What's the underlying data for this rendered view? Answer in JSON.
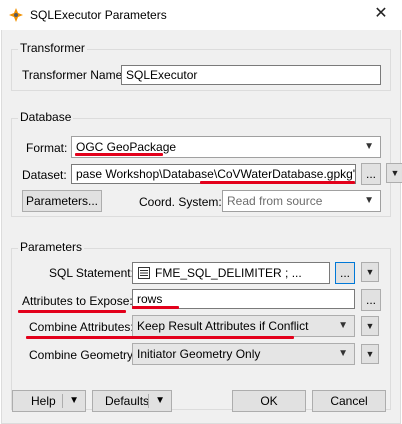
{
  "window": {
    "title": "SQLExecutor Parameters",
    "close_glyph": "✕"
  },
  "transformer": {
    "legend": "Transformer",
    "name_label": "Transformer Name:",
    "name_value": "SQLExecutor"
  },
  "database": {
    "legend": "Database",
    "format_label": "Format:",
    "format_value": "OGC GeoPackage",
    "dataset_label": "Dataset:",
    "dataset_value": "pase Workshop\\Database\\CoVWaterDatabase.gpkg\"",
    "dataset_browse": "...",
    "parameters_button": "Parameters...",
    "coord_label": "Coord. System:",
    "coord_value": "Read from source"
  },
  "parameters": {
    "legend": "Parameters",
    "sql_label": "SQL Statement:",
    "sql_value": "FME_SQL_DELIMITER ; ...",
    "sql_browse": "...",
    "attrs_label": "Attributes to Expose:",
    "attrs_value": "rows",
    "attrs_browse": "...",
    "combine_attr_label": "Combine Attributes:",
    "combine_attr_value": "Keep Result Attributes if Conflict",
    "combine_geom_label": "Combine Geometry:",
    "combine_geom_value": "Initiator Geometry Only"
  },
  "footer": {
    "help": "Help",
    "defaults": "Defaults",
    "ok": "OK",
    "cancel": "Cancel"
  },
  "colors": {
    "annotation": "#e3001b",
    "focus": "#0078d7"
  }
}
